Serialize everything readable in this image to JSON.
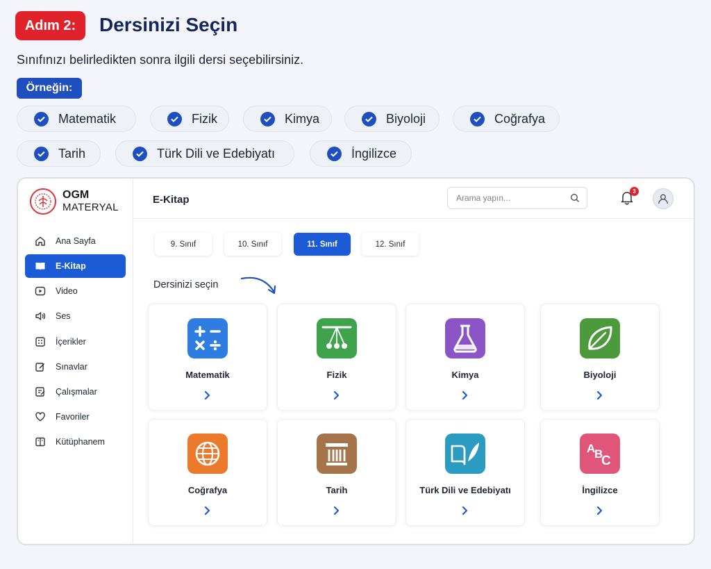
{
  "header": {
    "step_label": "Adım 2:",
    "title": "Dersinizi Seçin",
    "intro": "Sınıfınızı belirledikten sonra ilgili dersi seçebilirsiniz.",
    "example_label": "Örneğin:"
  },
  "example_chips": [
    "Matematik",
    "Fizik",
    "Kimya",
    "Biyoloji",
    "Coğrafya",
    "Tarih",
    "Türk Dili ve Edebiyatı",
    "İngilizce"
  ],
  "app": {
    "logo": {
      "line1": "OGM",
      "line2": "MATERYAL"
    },
    "sidebar": [
      {
        "label": "Ana Sayfa",
        "icon": "home-icon"
      },
      {
        "label": "E-Kitap",
        "icon": "book-icon",
        "active": true
      },
      {
        "label": "Video",
        "icon": "play-icon"
      },
      {
        "label": "Ses",
        "icon": "speaker-icon"
      },
      {
        "label": "İçerikler",
        "icon": "grid-icon"
      },
      {
        "label": "Sınavlar",
        "icon": "edit-icon"
      },
      {
        "label": "Çalışmalar",
        "icon": "note-icon"
      },
      {
        "label": "Favoriler",
        "icon": "heart-icon"
      },
      {
        "label": "Kütüphanem",
        "icon": "library-icon"
      }
    ],
    "page_name": "E-Kitap",
    "search_placeholder": "Arama yapın...",
    "notification_count": "3",
    "grades": [
      "9. Sınıf",
      "10. Sınıf",
      "11. Sınıf",
      "12. Sınıf"
    ],
    "active_grade": "11. Sınıf",
    "section_label": "Dersinizi seçin",
    "subjects": [
      {
        "name": "Matematik",
        "icon": "math-icon",
        "color": "#2f7de1"
      },
      {
        "name": "Fizik",
        "icon": "pendulum-icon",
        "color": "#3fa34d"
      },
      {
        "name": "Kimya",
        "icon": "flask-icon",
        "color": "#8b55c6"
      },
      {
        "name": "Biyoloji",
        "icon": "leaf-icon",
        "color": "#4c9a3b"
      },
      {
        "name": "Coğrafya",
        "icon": "globe-icon",
        "color": "#ec7a2c"
      },
      {
        "name": "Tarih",
        "icon": "column-icon",
        "color": "#a5744b"
      },
      {
        "name": "Türk Dili ve Edebiyatı",
        "icon": "book-feather-icon",
        "color": "#2c9bc1"
      },
      {
        "name": "İngilizce",
        "icon": "abc-icon",
        "color": "#e0557a"
      }
    ]
  },
  "colors": {
    "accent": "#1b5bd6",
    "step_red": "#e0232b",
    "chip_check": "#1f4fbf"
  }
}
